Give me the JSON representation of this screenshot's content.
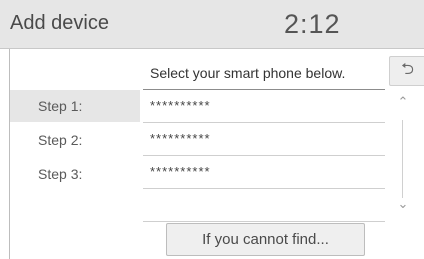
{
  "header": {
    "title": "Add device",
    "time": "2:12"
  },
  "prompt": "Select your smart phone below.",
  "back_icon": "back-arrow-icon",
  "steps": [
    {
      "label": "Step 1:",
      "device": "**********",
      "active": true
    },
    {
      "label": "Step 2:",
      "device": "**********",
      "active": false
    },
    {
      "label": "Step 3:",
      "device": "**********",
      "active": false
    }
  ],
  "scroll": {
    "up_icon": "double-chevron-up-icon",
    "down_icon": "double-chevron-down-icon"
  },
  "footer": {
    "button_label": "If you cannot find..."
  }
}
